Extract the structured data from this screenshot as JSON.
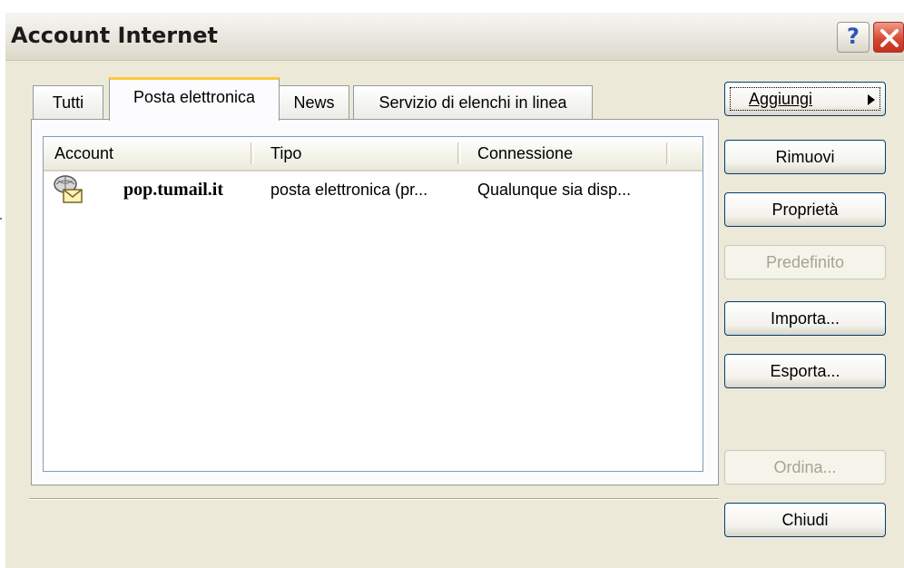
{
  "window": {
    "title": "Account Internet",
    "help_label": "?"
  },
  "tabs": [
    {
      "label": "Tutti"
    },
    {
      "label": "Posta elettronica",
      "selected": true
    },
    {
      "label": "News"
    },
    {
      "label": "Servizio di elenchi in linea"
    }
  ],
  "list": {
    "columns": [
      "Account",
      "Tipo",
      "Connessione"
    ],
    "rows": [
      {
        "account": "pop.tumail.it",
        "tipo": "posta elettronica (pr...",
        "connessione": "Qualunque sia disp...",
        "icon": "mail-account-icon"
      }
    ]
  },
  "buttons": {
    "aggiungi": "Aggiungi",
    "rimuovi": "Rimuovi",
    "proprieta": "Proprietà",
    "predefinito": "Predefinito",
    "importa": "Importa...",
    "esporta": "Esporta...",
    "ordina": "Ordina...",
    "chiudi": "Chiudi"
  },
  "colors": {
    "window_bg": "#ece9d8",
    "selected_tab_highlight": "#ffc83c",
    "close_button": "#d6452f",
    "disabled_text": "#a6a493"
  }
}
